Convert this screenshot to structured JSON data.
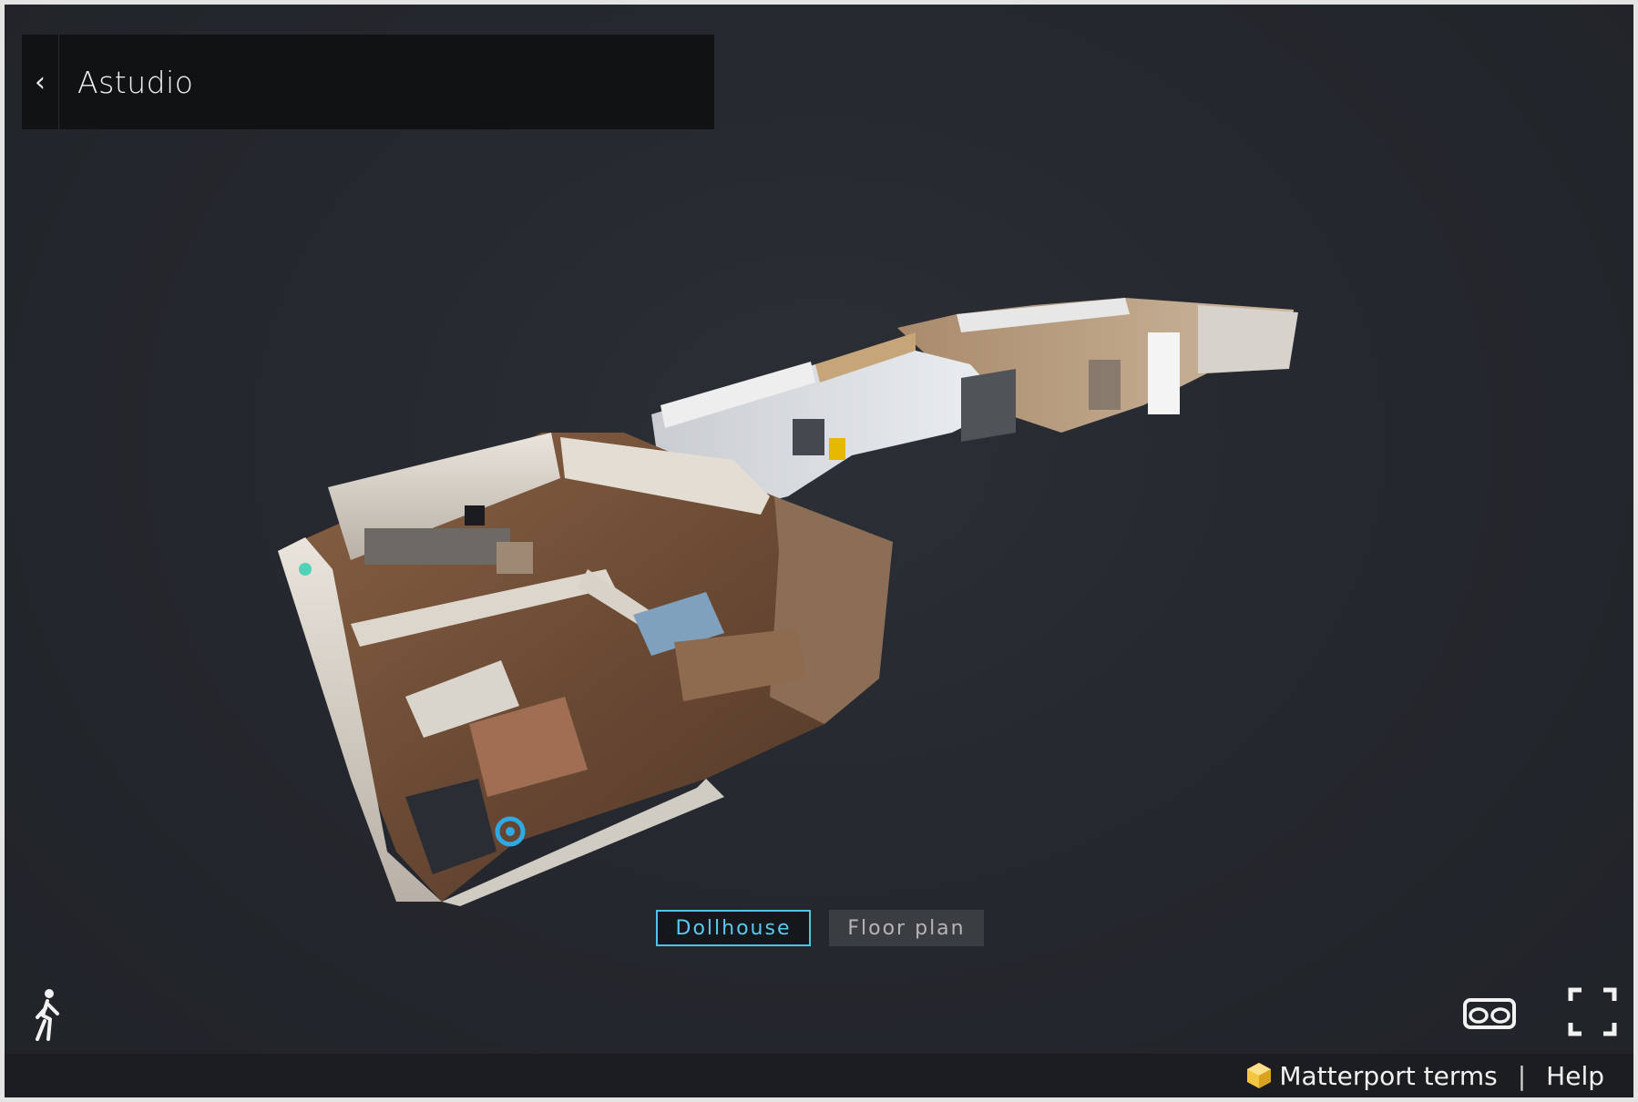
{
  "header": {
    "title": "Astudio",
    "back_icon": "chevron-left-icon"
  },
  "view_modes": {
    "dollhouse_label": "Dollhouse",
    "floorplan_label": "Floor plan",
    "active": "Dollhouse"
  },
  "controls": {
    "walk_icon": "walk-icon",
    "vr_icon": "vr-goggles-icon",
    "fullscreen_icon": "fullscreen-icon"
  },
  "footer": {
    "terms_label": "Matterport terms",
    "separator": "|",
    "help_label": "Help",
    "logo_icon": "matterport-logo-icon"
  },
  "colors": {
    "accent": "#4fc3eb",
    "background": "#24272d",
    "header_bg": "#111214",
    "footer_bg": "#1c1d20"
  }
}
